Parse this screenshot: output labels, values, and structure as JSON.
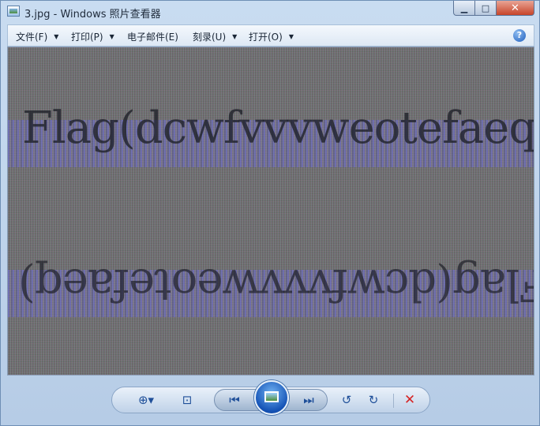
{
  "window": {
    "title": "3.jpg - Windows 照片查看器",
    "buttons": {
      "minimize": "▁",
      "maximize": "□",
      "close": "✕"
    }
  },
  "menubar": {
    "items": [
      {
        "label": "文件(F)"
      },
      {
        "label": "打印(P)"
      },
      {
        "label": "电子邮件(E)"
      },
      {
        "label": "刻录(U)"
      },
      {
        "label": "打开(O)"
      }
    ],
    "help_label": "?"
  },
  "image": {
    "text_top": "Flag(dcwfvvvweotefaeq)",
    "text_bottom": "Flag(dcwfvvvweotefaeq)"
  },
  "toolbar": {
    "icons": [
      "zoom-icon",
      "fit-window-icon",
      "previous-icon",
      "slideshow-icon",
      "next-icon",
      "rotate-left-icon",
      "rotate-right-icon",
      "delete-icon"
    ],
    "glyphs": {
      "zoom": "⊕▾",
      "fit": "⊡",
      "prev": "⏮",
      "next": "⏭",
      "rotate_left": "↺",
      "rotate_right": "↻",
      "delete": "✕"
    }
  }
}
